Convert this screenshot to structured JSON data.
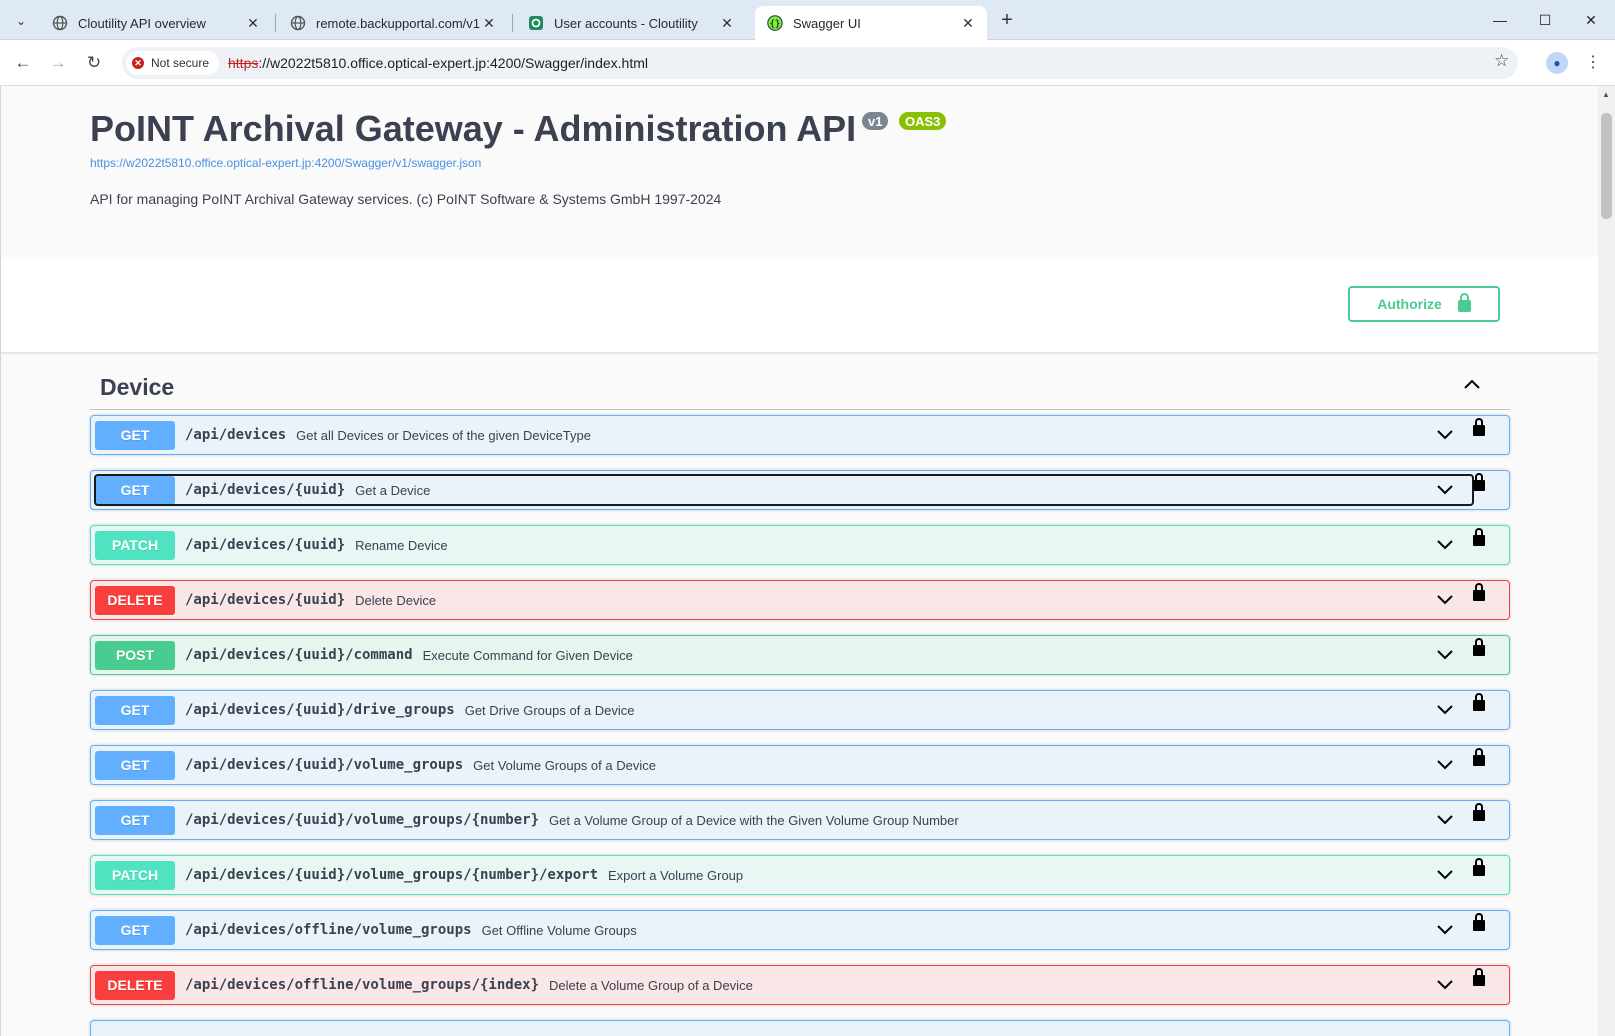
{
  "browser": {
    "tabs": [
      {
        "label": "Cloutility API overview",
        "active": false
      },
      {
        "label": "remote.backupportal.com/v1/u",
        "active": false
      },
      {
        "label": "User accounts - Cloutility",
        "active": false
      },
      {
        "label": "Swagger UI",
        "active": true
      }
    ],
    "security_chip": "Not secure",
    "url_protocol": "https",
    "url_rest": "://w2022t5810.office.optical-expert.jp:4200/Swagger/index.html"
  },
  "info": {
    "title": "PoINT Archival Gateway - Administration API",
    "version": "v1",
    "oas": "OAS3",
    "spec_url": "https://w2022t5810.office.optical-expert.jp:4200/Swagger/v1/swagger.json",
    "description": "API for managing PoINT Archival Gateway services. (c) PoINT Software & Systems GmbH 1997-2024"
  },
  "authorize_label": "Authorize",
  "tag": {
    "name": "Device"
  },
  "operations": [
    {
      "method": "GET",
      "path": "/api/devices",
      "summary": "Get all Devices or Devices of the given DeviceType"
    },
    {
      "method": "GET",
      "path": "/api/devices/{uuid}",
      "summary": "Get a Device"
    },
    {
      "method": "PATCH",
      "path": "/api/devices/{uuid}",
      "summary": "Rename Device"
    },
    {
      "method": "DELETE",
      "path": "/api/devices/{uuid}",
      "summary": "Delete Device"
    },
    {
      "method": "POST",
      "path": "/api/devices/{uuid}/command",
      "summary": "Execute Command for Given Device"
    },
    {
      "method": "GET",
      "path": "/api/devices/{uuid}/drive_groups",
      "summary": "Get Drive Groups of a Device"
    },
    {
      "method": "GET",
      "path": "/api/devices/{uuid}/volume_groups",
      "summary": "Get Volume Groups of a Device"
    },
    {
      "method": "GET",
      "path": "/api/devices/{uuid}/volume_groups/{number}",
      "summary": "Get a Volume Group of a Device with the Given Volume Group Number"
    },
    {
      "method": "PATCH",
      "path": "/api/devices/{uuid}/volume_groups/{number}/export",
      "summary": "Export a Volume Group"
    },
    {
      "method": "GET",
      "path": "/api/devices/offline/volume_groups",
      "summary": "Get Offline Volume Groups"
    },
    {
      "method": "DELETE",
      "path": "/api/devices/offline/volume_groups/{index}",
      "summary": "Delete a Volume Group of a Device"
    }
  ],
  "colors": {
    "get": "#61affe",
    "patch": "#50e3c2",
    "delete": "#f93e3e",
    "post": "#49cc90",
    "oas_badge": "#89bf04"
  }
}
